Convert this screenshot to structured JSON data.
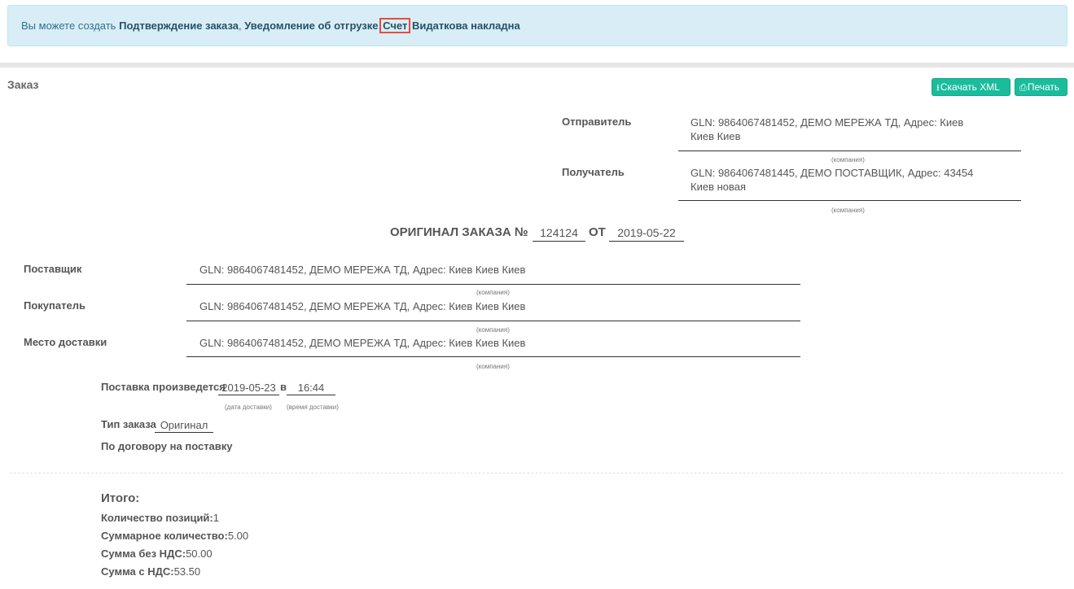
{
  "alert": {
    "prefix": "Вы можете создать",
    "links": [
      "Подтверждение заказа",
      "Уведомление об отгрузке",
      "Счет",
      "Видаткова накладна"
    ]
  },
  "panel": {
    "title": "Заказ",
    "download_xml": "Скачать XML",
    "print": "Печать",
    "download_icon": "download-icon",
    "print_icon": "print-icon"
  },
  "header": {
    "sender_label": "Отправитель",
    "sender_value": "GLN: 9864067481452, ДЕМО МЕРЕЖА ТД, Адрес: Киев Киев Киев",
    "recipient_label": "Получатель",
    "recipient_value": "GLN: 9864067481445, ДЕМО ПОСТАВЩИК, Адрес: 43454 Киев новая",
    "company_caption": "(компания)"
  },
  "order": {
    "title": "ОРИГИНАЛ ЗАКАЗА №",
    "number": "124124",
    "from_label": "ОТ",
    "date": "2019-05-22"
  },
  "parties": {
    "supplier_label": "Поставщик",
    "supplier_value": "GLN: 9864067481452, ДЕМО МЕРЕЖА ТД, Адрес: Киев Киев Киев",
    "buyer_label": "Покупатель",
    "buyer_value": "GLN: 9864067481452, ДЕМО МЕРЕЖА ТД, Адрес: Киев Киев Киев",
    "delivery_label": "Место доставки",
    "delivery_value": "GLN: 9864067481452, ДЕМО МЕРЕЖА ТД, Адрес: Киев Киев Киев",
    "company_caption": "(компания)"
  },
  "delivery": {
    "label": "Поставка произведется",
    "date": "2019-05-23",
    "at_label": "в",
    "time": "16:44",
    "date_caption": "(дата доставки)",
    "time_caption": "(время доставки)",
    "order_type_label": "Тип заказа",
    "order_type_value": "Оригинал",
    "contract_label": "По договору на поставку"
  },
  "totals": {
    "title": "Итого:",
    "positions_label": "Количество позиций:",
    "positions_value": "1",
    "qty_label": "Суммарное количество:",
    "qty_value": "5.00",
    "net_label": "Сумма без НДС:",
    "net_value": "50.00",
    "gross_label": "Сумма с НДС:",
    "gross_value": "53.50"
  }
}
